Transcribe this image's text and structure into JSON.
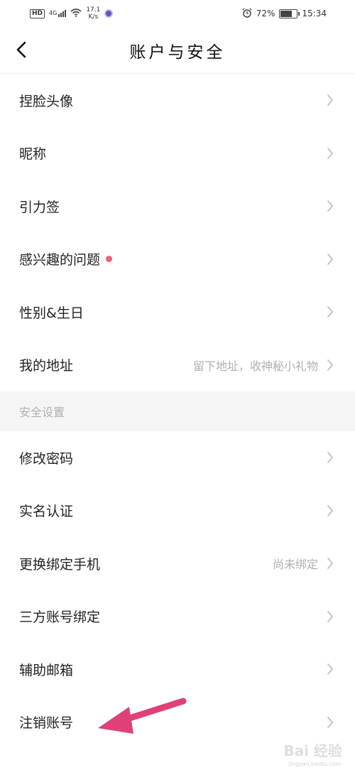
{
  "status_bar": {
    "hd": "HD",
    "signal_label": "4G",
    "speed_value": "17.1",
    "speed_unit": "K/s",
    "battery_text": "72%",
    "battery_level": 0.72,
    "time": "15:34"
  },
  "header": {
    "title": "账户与安全"
  },
  "profile_items": [
    {
      "label": "捏脸头像",
      "value": "",
      "dot": false
    },
    {
      "label": "昵称",
      "value": "",
      "dot": false
    },
    {
      "label": "引力签",
      "value": "",
      "dot": false
    },
    {
      "label": "感兴趣的问题",
      "value": "",
      "dot": true
    },
    {
      "label": "性别&生日",
      "value": "",
      "dot": false
    },
    {
      "label": "我的地址",
      "value": "留下地址，收神秘小礼物",
      "dot": false
    }
  ],
  "security_section": {
    "title": "安全设置"
  },
  "security_items": [
    {
      "label": "修改密码",
      "value": ""
    },
    {
      "label": "实名认证",
      "value": ""
    },
    {
      "label": "更换绑定手机",
      "value": "尚未绑定"
    },
    {
      "label": "三方账号绑定",
      "value": ""
    },
    {
      "label": "辅助邮箱",
      "value": ""
    },
    {
      "label": "注销账号",
      "value": ""
    }
  ],
  "colors": {
    "accent_dot": "#f06070",
    "annotation_arrow": "#e0407a",
    "section_bg": "#f5f5f5",
    "secondary_text": "#b0b0b0"
  },
  "watermark": {
    "brand": "Bai 经验",
    "url": "jingyan.baidu.com"
  }
}
